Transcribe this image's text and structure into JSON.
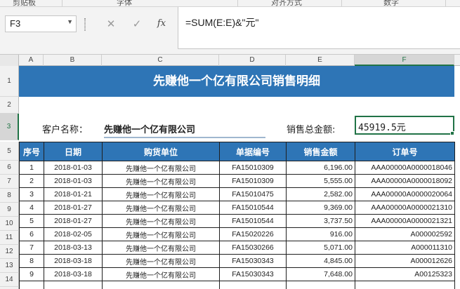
{
  "ribbon": {
    "groups": [
      "剪贴板",
      "字体",
      "对齐方式",
      "数字"
    ]
  },
  "formula_bar": {
    "name_box": "F3",
    "cancel_icon": "close-icon",
    "enter_icon": "check-icon",
    "fx_label": "fx",
    "formula": "=SUM(E:E)&\"元\""
  },
  "grid": {
    "columns": [
      "A",
      "B",
      "C",
      "D",
      "E",
      "F"
    ],
    "active_column": "F",
    "rows": [
      "1",
      "2",
      "3",
      "5",
      "6",
      "7",
      "8",
      "9",
      "10",
      "11",
      "12",
      "13",
      "14",
      "15"
    ],
    "active_row": "3"
  },
  "sheet": {
    "title": "先赚他一个亿有限公司销售明细",
    "customer_label": "客户名称：",
    "customer_name": "先赚他一个亿有限公司",
    "total_label": "销售总金额:",
    "total_value": "45919.5元",
    "header_color": "#2e75b6",
    "selection_color": "#217346"
  },
  "table": {
    "headers": [
      "序号",
      "日期",
      "购货单位",
      "单据编号",
      "销售金额",
      "订单号"
    ],
    "rows": [
      [
        "1",
        "2018-01-03",
        "先赚他一个亿有限公司",
        "FA15010309",
        "6,196.00",
        "AAA00000A0000018046"
      ],
      [
        "2",
        "2018-01-03",
        "先赚他一个亿有限公司",
        "FA15010309",
        "5,555.00",
        "AAA00000A0000018092"
      ],
      [
        "3",
        "2018-01-21",
        "先赚他一个亿有限公司",
        "FA15010475",
        "2,582.00",
        "AAA00000A0000020064"
      ],
      [
        "4",
        "2018-01-27",
        "先赚他一个亿有限公司",
        "FA15010544",
        "9,369.00",
        "AAA00000A0000021310"
      ],
      [
        "5",
        "2018-01-27",
        "先赚他一个亿有限公司",
        "FA15010544",
        "3,737.50",
        "AAA00000A0000021321"
      ],
      [
        "6",
        "2018-02-05",
        "先赚他一个亿有限公司",
        "FA15020226",
        "916.00",
        "A000002592"
      ],
      [
        "7",
        "2018-03-13",
        "先赚他一个亿有限公司",
        "FA15030266",
        "5,071.00",
        "A000011310"
      ],
      [
        "8",
        "2018-03-18",
        "先赚他一个亿有限公司",
        "FA15030343",
        "4,845.00",
        "A000012626"
      ],
      [
        "9",
        "2018-03-18",
        "先赚他一个亿有限公司",
        "FA15030343",
        "7,648.00",
        "A00125323"
      ],
      [
        "",
        "",
        "",
        "",
        "",
        ""
      ]
    ]
  }
}
